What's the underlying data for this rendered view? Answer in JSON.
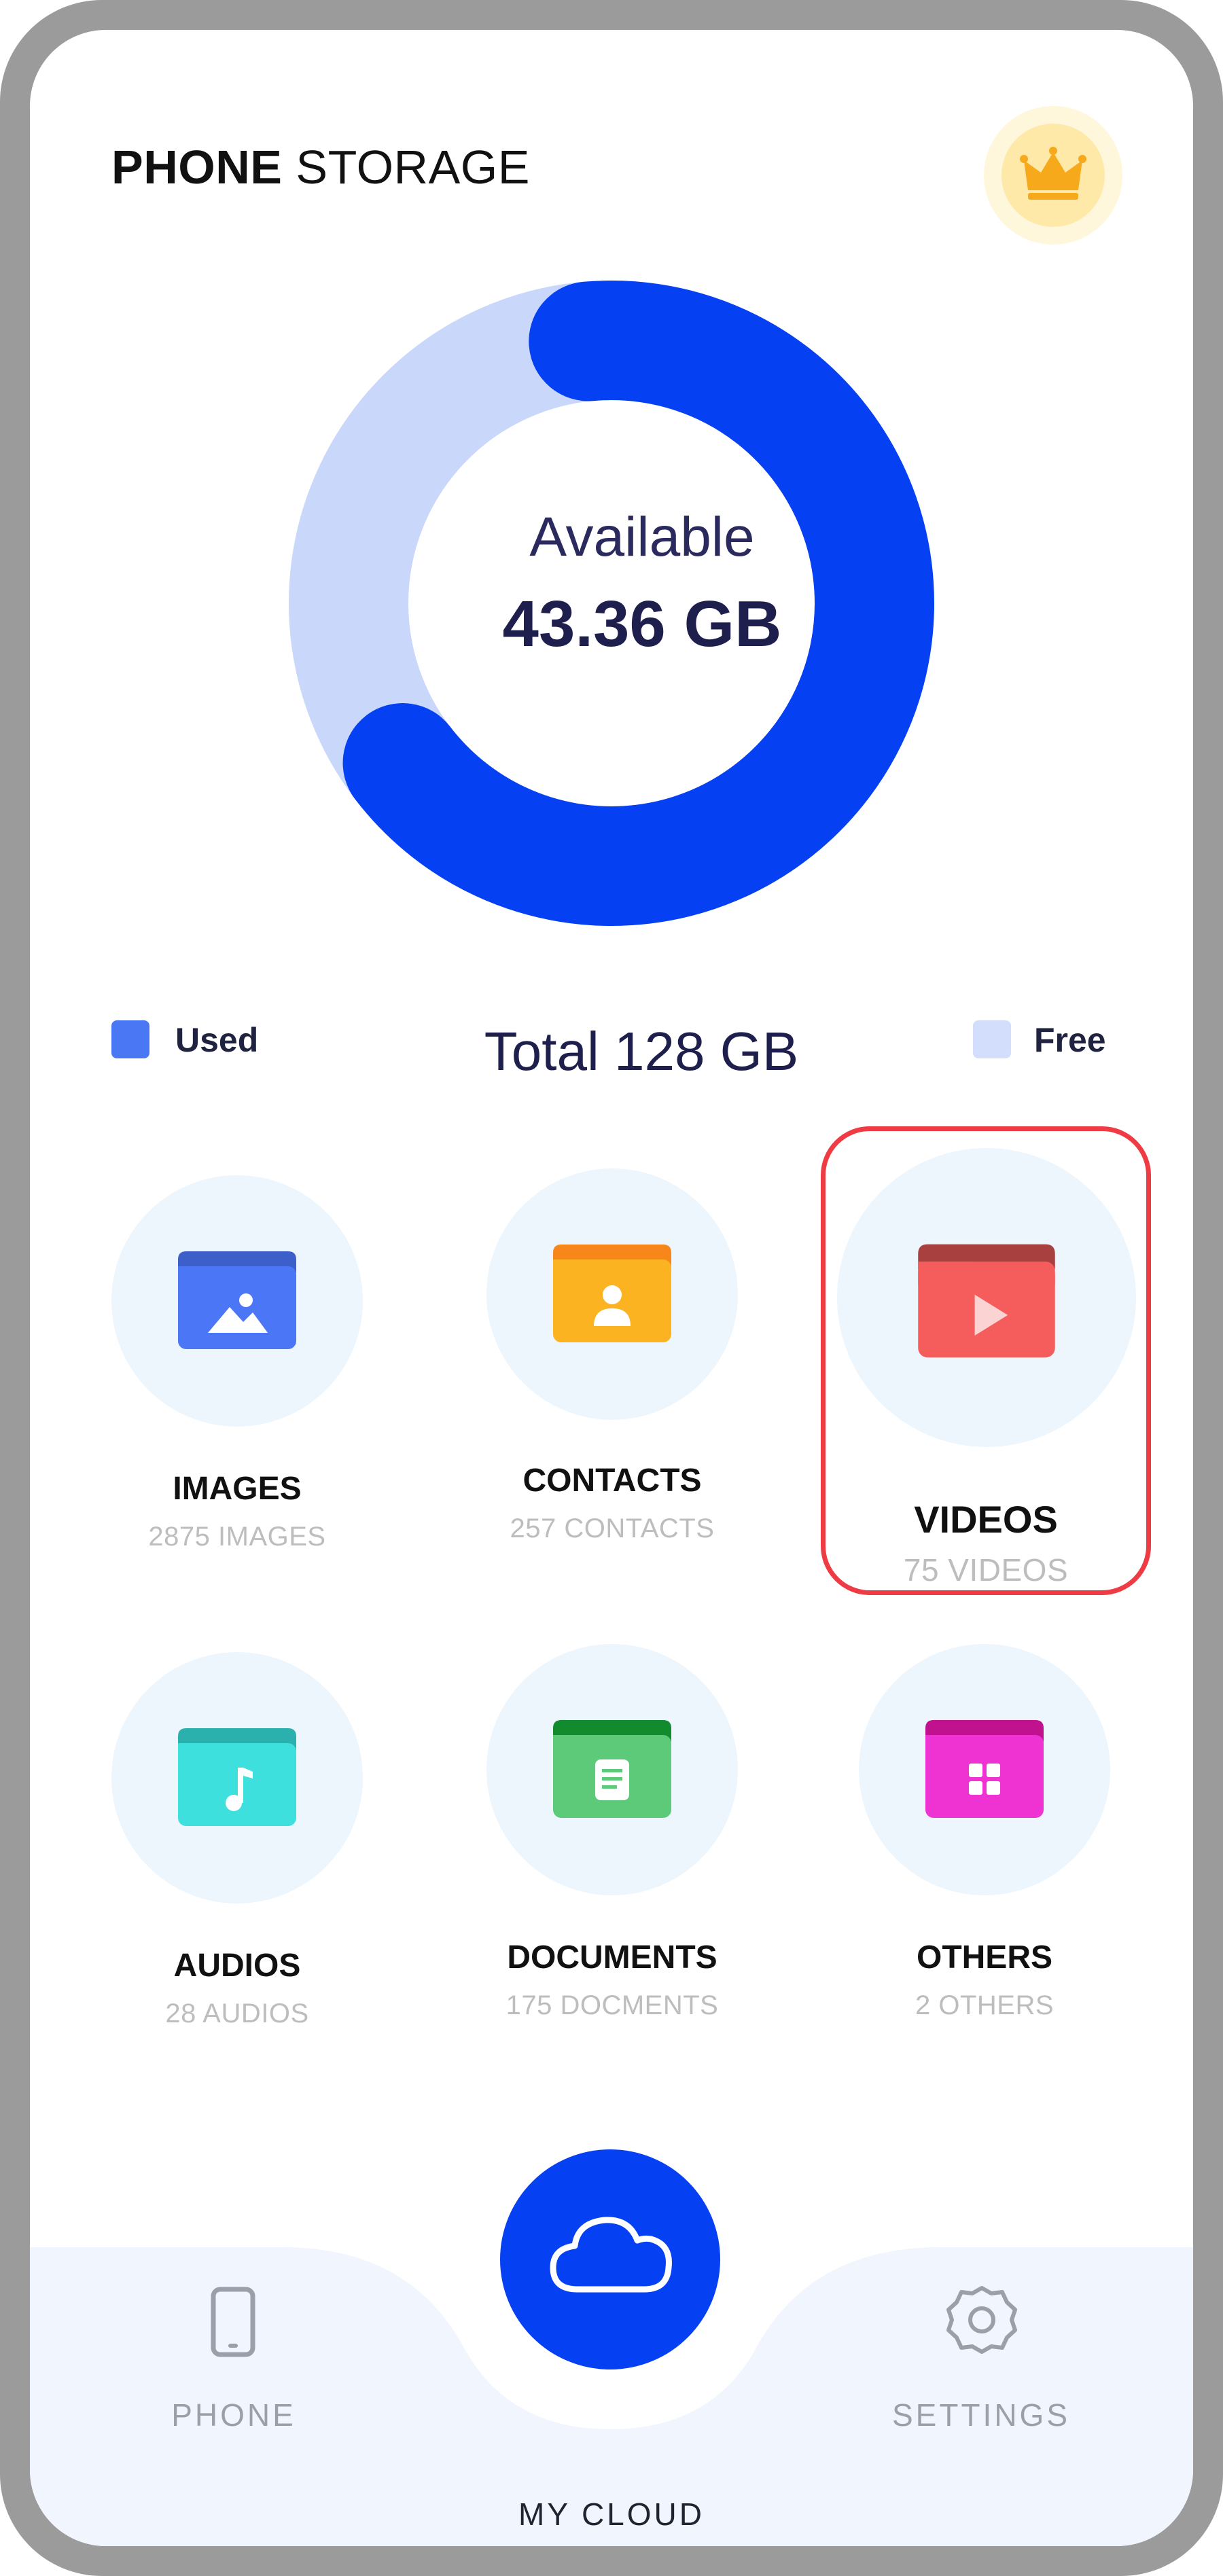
{
  "header": {
    "title_bold": "PHONE",
    "title_light": " STORAGE",
    "premium_icon": "crown-icon"
  },
  "storage": {
    "available_label": "Available",
    "available_value": "43.36 GB",
    "total_label": "Total 128 GB",
    "used_fraction": 0.66,
    "legend": {
      "used_label": "Used",
      "free_label": "Free"
    },
    "colors": {
      "used": "#0640f3",
      "free": "#c9d7fb",
      "used_legend": "#4a78f5",
      "free_legend": "#d3ddfc"
    }
  },
  "categories": [
    {
      "name": "IMAGES",
      "count": "2875 IMAGES",
      "icon": "image-folder-icon",
      "color": "#4b76f6",
      "tab": "#3d5fc9"
    },
    {
      "name": "CONTACTS",
      "count": "257 CONTACTS",
      "icon": "contact-folder-icon",
      "color": "#fbb321",
      "tab": "#f7871a"
    },
    {
      "name": "VIDEOS",
      "count": "75 VIDEOS",
      "icon": "video-folder-icon",
      "color": "#f55c5c",
      "tab": "#a84040"
    },
    {
      "name": "AUDIOS",
      "count": "28 AUDIOS",
      "icon": "audio-folder-icon",
      "color": "#3de0dd",
      "tab": "#2ab1ad"
    },
    {
      "name": "DOCUMENTS",
      "count": "175 DOCMENTS",
      "icon": "document-folder-icon",
      "color": "#5cca78",
      "tab": "#128a2e"
    },
    {
      "name": "OTHERS",
      "count": "2 OTHERS",
      "icon": "others-folder-icon",
      "color": "#ef33d3",
      "tab": "#c0128f"
    }
  ],
  "nav": {
    "phone_label": "PHONE",
    "cloud_label": "MY CLOUD",
    "settings_label": "SETTINGS",
    "phone_icon": "phone-icon",
    "cloud_icon": "cloud-icon",
    "settings_icon": "gear-icon"
  }
}
